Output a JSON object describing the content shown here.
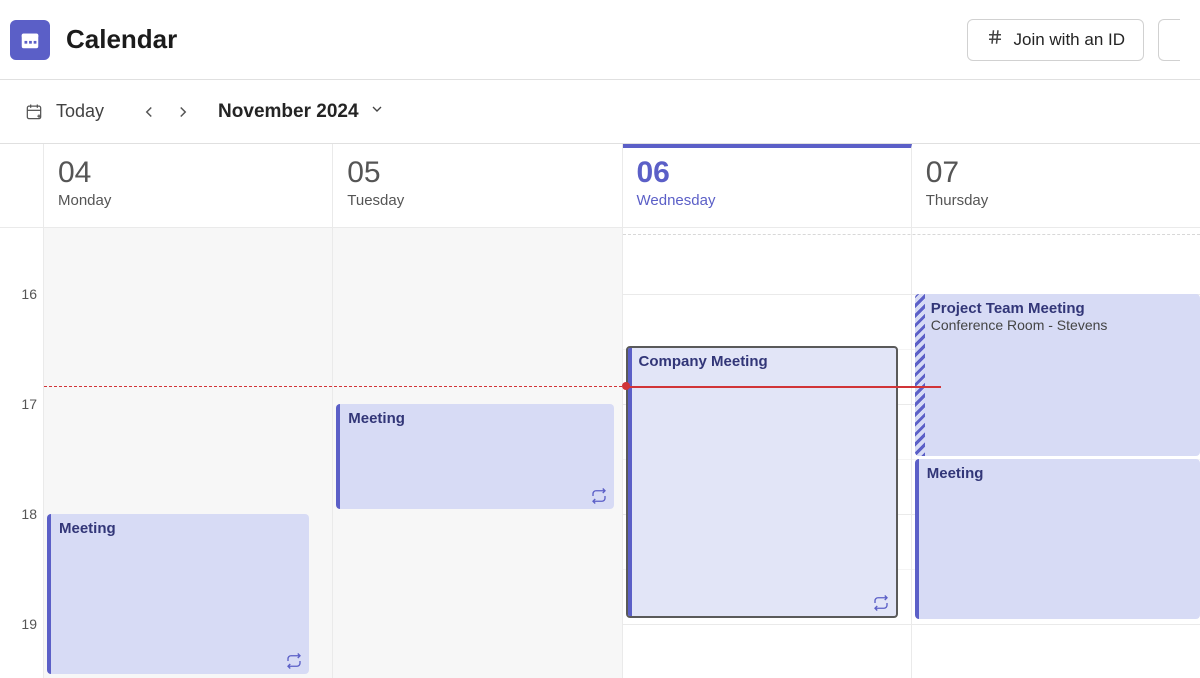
{
  "header": {
    "app_title": "Calendar",
    "join_button_label": "Join with an ID"
  },
  "nav": {
    "today_label": "Today",
    "month_label": "November 2024"
  },
  "hours": [
    "16",
    "17",
    "18",
    "19"
  ],
  "days": [
    {
      "num": "04",
      "name": "Monday",
      "is_today": false
    },
    {
      "num": "05",
      "name": "Tuesday",
      "is_today": false
    },
    {
      "num": "06",
      "name": "Wednesday",
      "is_today": true
    },
    {
      "num": "07",
      "name": "Thursday",
      "is_today": false
    }
  ],
  "events": {
    "mon_meeting": {
      "title": "Meeting"
    },
    "tue_meeting": {
      "title": "Meeting"
    },
    "wed_company": {
      "title": "Company Meeting"
    },
    "thu_project": {
      "title": "Project Team Meeting",
      "location": "Conference Room - Stevens"
    },
    "thu_meeting": {
      "title": "Meeting"
    }
  },
  "colors": {
    "accent": "#5b5fc7",
    "event_bg": "#d7dbf5",
    "now_line": "#d13438"
  }
}
